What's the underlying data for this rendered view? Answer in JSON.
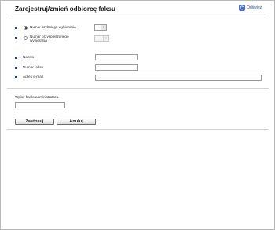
{
  "page": {
    "title": "Zarejestruj/zmień odbiorcę faksu",
    "refresh_label": "Odśwież"
  },
  "dial": {
    "quick_dial_label": "Numer szybkiego wybierania",
    "speed_dial_label": "Numer przyspieszonego wybierania",
    "quick_dial_checked": true,
    "speed_dial_checked": false
  },
  "fields": {
    "name_label": "Nazwa",
    "fax_label": "Numer faksu",
    "email_label": "Adres e-mail",
    "name_value": "",
    "fax_value": "",
    "email_value": ""
  },
  "admin": {
    "password_label": "Wpisz hasło administratora.",
    "password_value": ""
  },
  "buttons": {
    "apply": "Zastosuj",
    "cancel": "Anuluj"
  },
  "icons": {
    "refresh": "refresh-icon"
  }
}
